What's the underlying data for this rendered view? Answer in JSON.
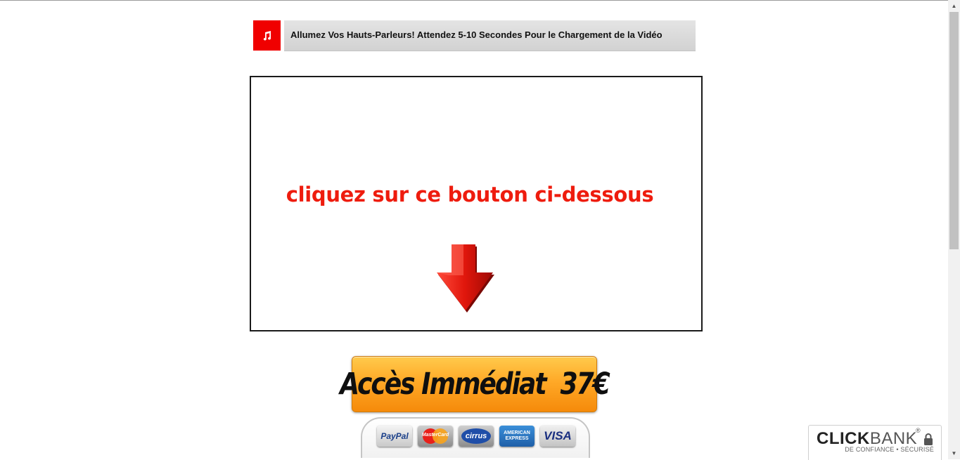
{
  "sound_banner": {
    "icon": "music-note-icon",
    "text": "Allumez Vos Hauts-Parleurs! Attendez 5-10 Secondes Pour le Chargement de la Vidéo"
  },
  "video": {
    "caption": "cliquez sur ce bouton ci-dessous",
    "icon": "down-arrow-icon"
  },
  "buy_button": {
    "label": "Accès Immédiat  37€",
    "color": "#ffa927"
  },
  "payment_cards": {
    "paypal": "PayPal",
    "mastercard": "MasterCard",
    "cirrus": "cirrus",
    "amex_line1": "AMERICAN",
    "amex_line2": "EXPRESS",
    "visa": "VISA"
  },
  "clickbank": {
    "brand_bold": "CLICK",
    "brand_light": "BANK",
    "registered": "®",
    "tagline": "DE CONFIANCE • SÉCURISÉ",
    "icon": "lock-icon"
  },
  "colors": {
    "accent_red": "#f00000",
    "caption_red": "#ee1c0e",
    "button_orange": "#ffa927"
  }
}
